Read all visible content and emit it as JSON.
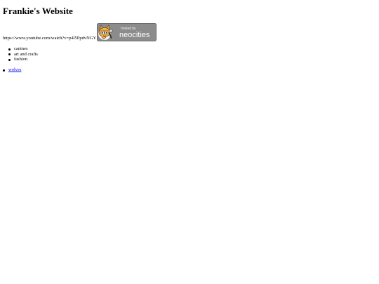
{
  "page": {
    "title": "Frankie's Website",
    "video_link_text": "https://www.youtube.com/watch?v=p4l5PpdvNGY"
  },
  "badge": {
    "top_text": "hosted by",
    "brand_text": "neocities",
    "icon": "neocities-cat-logo",
    "bg_color": "#8c8c8c"
  },
  "topics": [
    "canines",
    "art and crafts",
    "fashion"
  ],
  "links": [
    {
      "label": "wolves"
    }
  ]
}
